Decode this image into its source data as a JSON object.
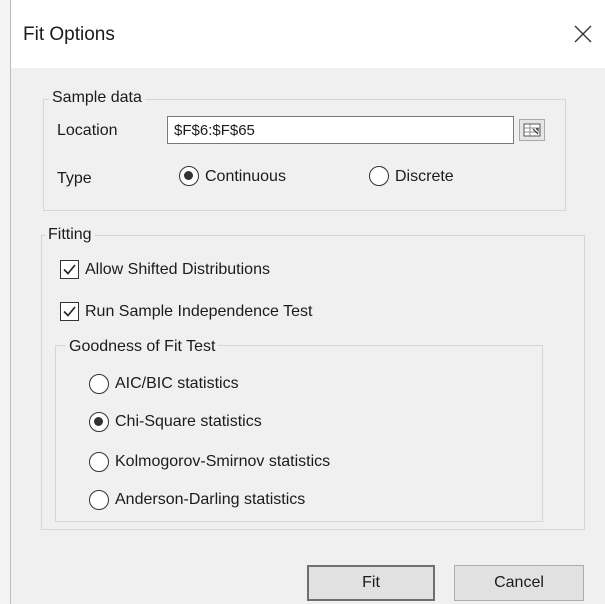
{
  "dialog": {
    "title": "Fit Options",
    "close_icon": "close-icon"
  },
  "sample_data": {
    "legend": "Sample data",
    "location_label": "Location",
    "location_value": "$F$6:$F$65",
    "picker_icon": "range-picker-icon",
    "type_label": "Type",
    "type_options": [
      {
        "label": "Continuous",
        "selected": true
      },
      {
        "label": "Discrete",
        "selected": false
      }
    ]
  },
  "fitting": {
    "legend": "Fitting",
    "allow_shifted": {
      "label": "Allow Shifted Distributions",
      "checked": true
    },
    "run_independence": {
      "label": "Run Sample Independence Test",
      "checked": true
    },
    "gof": {
      "legend": "Goodness of Fit Test",
      "options": [
        {
          "label": "AIC/BIC statistics",
          "selected": false
        },
        {
          "label": "Chi-Square statistics",
          "selected": true
        },
        {
          "label": "Kolmogorov-Smirnov statistics",
          "selected": false
        },
        {
          "label": "Anderson-Darling statistics",
          "selected": false
        }
      ]
    }
  },
  "buttons": {
    "fit": "Fit",
    "cancel": "Cancel"
  }
}
